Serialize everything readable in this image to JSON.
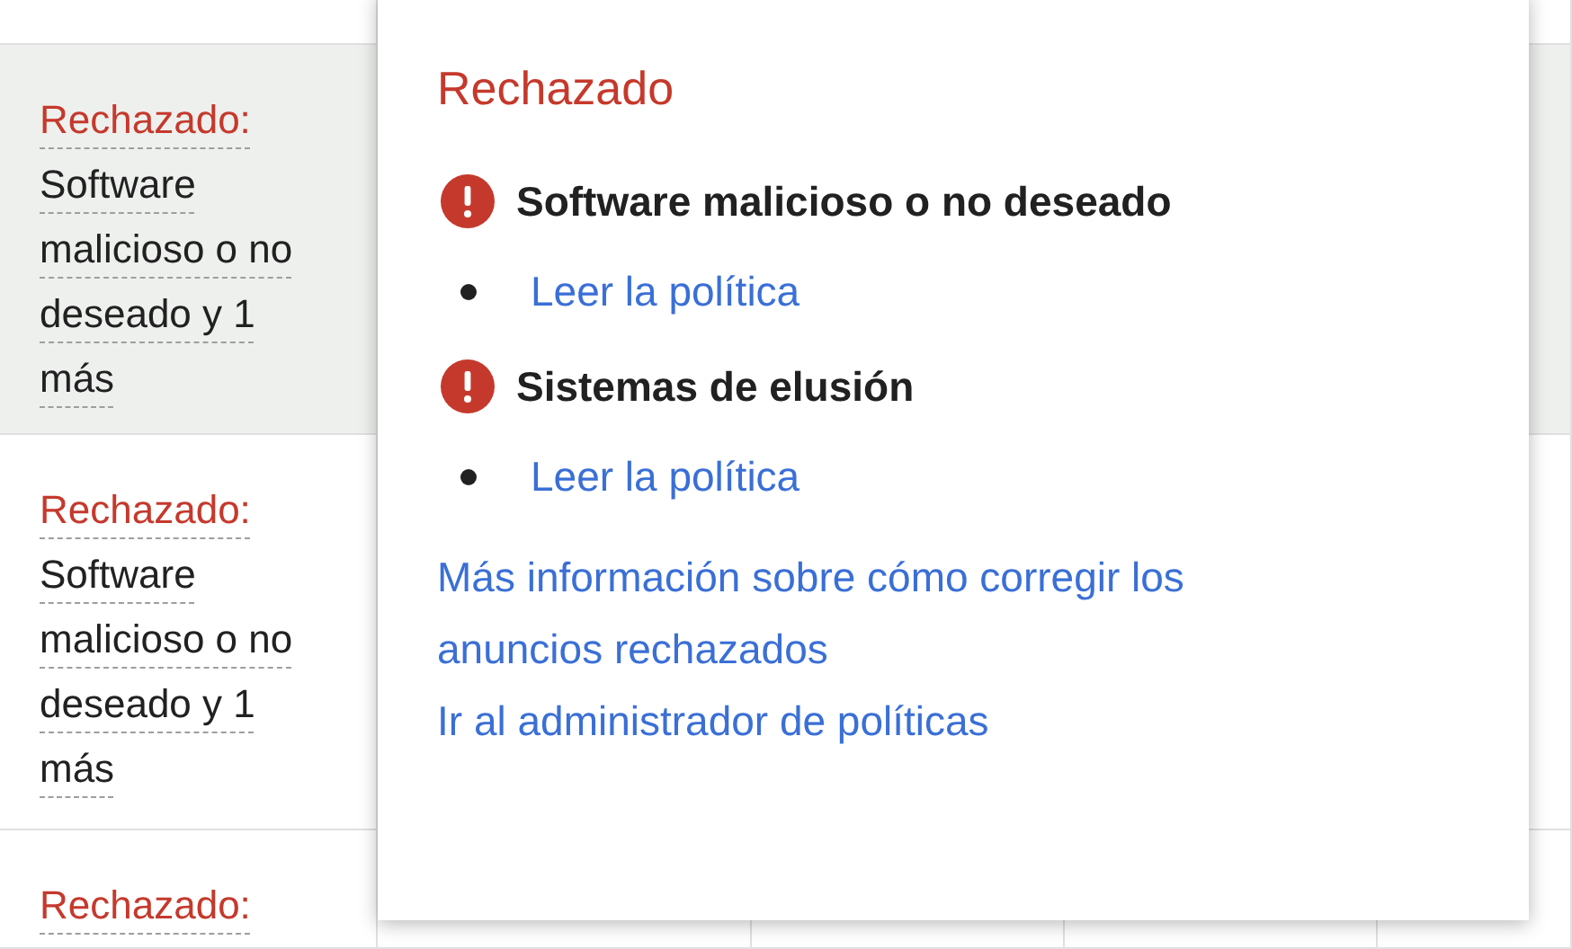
{
  "table": {
    "rows": [
      {
        "status": "Rechazado:",
        "reason": "Software malicioso o no deseado y 1 más",
        "selected": true
      },
      {
        "status": "Rechazado:",
        "reason": "Software malicioso o no deseado y 1 más",
        "selected": false
      },
      {
        "status": "Rechazado:",
        "selected": false
      }
    ]
  },
  "popover": {
    "title": "Rechazado",
    "policies": [
      {
        "name": "Software malicioso o no deseado",
        "link": "Leer la política"
      },
      {
        "name": "Sistemas de elusión",
        "link": "Leer la política"
      }
    ],
    "links": [
      "Más información sobre cómo corregir los anuncios rechazados",
      "Ir al administrador de políticas"
    ]
  }
}
